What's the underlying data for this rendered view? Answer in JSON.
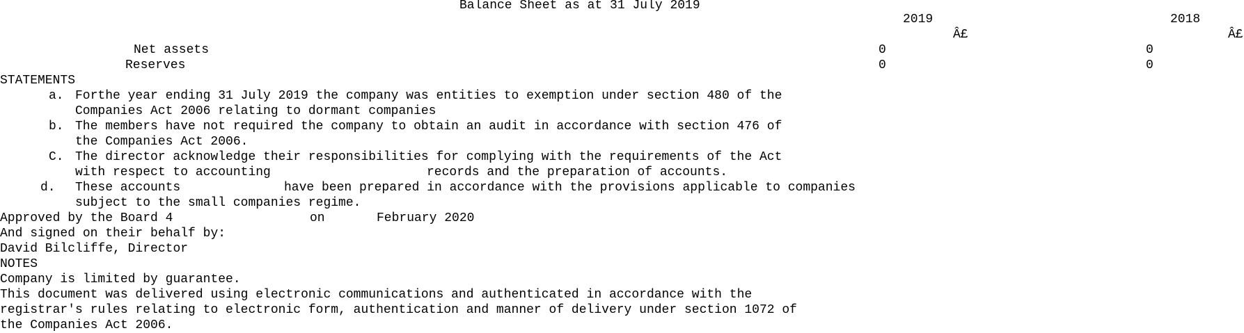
{
  "title": "Balance Sheet as at 31 July 2019",
  "columns": {
    "year_current": "2019",
    "year_prior": "2018",
    "currency_current": "Â£",
    "currency_prior": "Â£"
  },
  "balance_rows": [
    {
      "label": "Net assets",
      "current": "0",
      "prior": "0"
    },
    {
      "label": "Reserves",
      "current": "0",
      "prior": "0"
    }
  ],
  "statements": {
    "heading": "STATEMENTS",
    "items": [
      {
        "marker": "a.",
        "line1": "Forthe year ending 31 July 2019 the company was entities to exemption under section 480 of the",
        "line2": "Companies Act 2006 relating to dormant companies"
      },
      {
        "marker": "b.",
        "line1": "The members have not required the company to obtain an audit in accordance with section 476 of",
        "line2": "the Companies Act 2006."
      },
      {
        "marker": "C.",
        "line1": "The director acknowledge their responsibilities for complying with the requirements of the Act",
        "line2a": "with respect to accounting",
        "line2b": "records and the preparation of accounts."
      },
      {
        "marker": "d.",
        "line1a": "These accounts",
        "line1b": "have been prepared in accordance with the provisions applicable to companies",
        "line2": "subject to the small companies regime."
      }
    ]
  },
  "approval": {
    "part1": "Approved by the Board 4",
    "part2": "on",
    "part3": "February 2020",
    "signed_line": "And signed on their behalf by:",
    "signatory": "David Bilcliffe, Director"
  },
  "notes": {
    "heading": "NOTES",
    "lines": [
      "Company is limited by guarantee.",
      "This document was delivered using electronic communications and authenticated in accordance with the",
      "registrar's rules relating to electronic form, authentication and manner of delivery under section 1072 of",
      "the Companies Act 2006."
    ]
  }
}
